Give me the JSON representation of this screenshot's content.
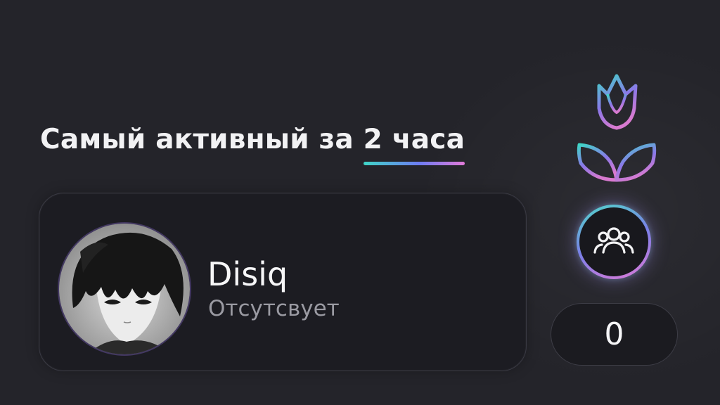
{
  "header": {
    "title_prefix": "Самый активный за ",
    "title_accent": "2 часа"
  },
  "user": {
    "name": "Disiq",
    "status": "Отсутсвует"
  },
  "stats": {
    "count": "0"
  },
  "icons": {
    "flower": "flower-icon",
    "members": "users-group-icon"
  },
  "colors": {
    "background": "#24242a",
    "card": "#1c1c22",
    "accent_teal": "#3fd6c7",
    "accent_violet": "#6d7cf2",
    "accent_pink": "#e27ad8"
  }
}
